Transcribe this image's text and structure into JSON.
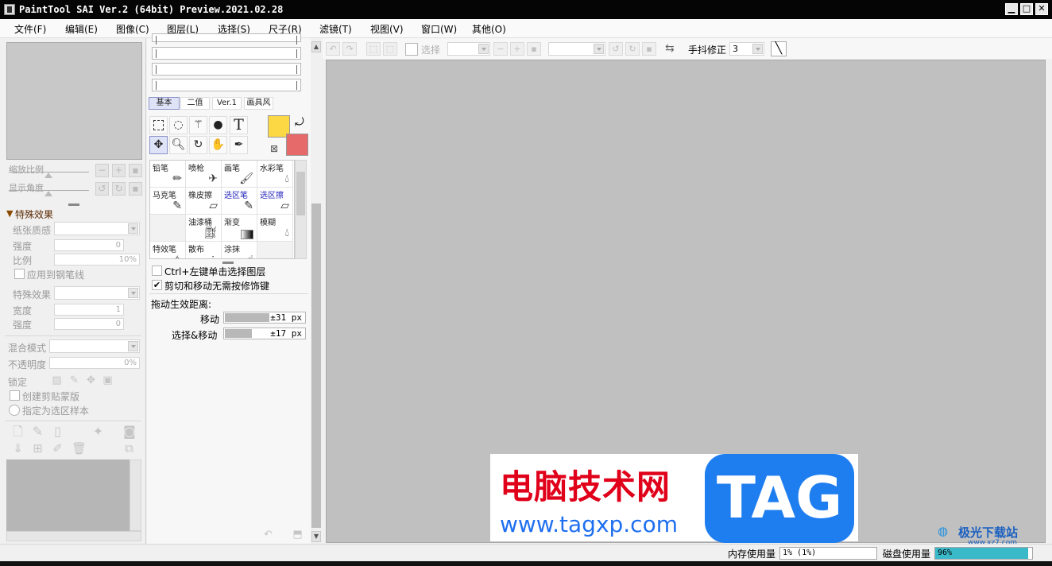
{
  "window": {
    "title": "PaintTool SAI Ver.2 (64bit) Preview.2021.02.28",
    "minimize": "▁",
    "maximize": "□",
    "close": "✕"
  },
  "menu": [
    "文件(F)",
    "编辑(E)",
    "图像(C)",
    "图层(L)",
    "选择(S)",
    "尺子(R)",
    "滤镜(T)",
    "视图(V)",
    "窗口(W)",
    "其他(O)"
  ],
  "navigator": {
    "zoom_label": "缩放比例",
    "angle_label": "显示角度"
  },
  "effects": {
    "header": "特殊效果",
    "paper_texture": "纸张质感",
    "strength": "强度",
    "strength_value": "0",
    "scale": "比例",
    "scale_value": "10%",
    "apply_to_pen": "应用到钢笔线",
    "special_effect": "特殊效果",
    "width": "宽度",
    "width_value": "1",
    "strength2": "强度",
    "strength2_value": "0"
  },
  "layer": {
    "blend_mode": "混合模式",
    "opacity": "不透明度",
    "opacity_value": "0%",
    "lock": "锁定",
    "clip_mask": "创建剪贴蒙版",
    "selection_source": "指定为选区样本"
  },
  "tool_tabs": [
    "基本",
    "二值",
    "Ver.1",
    "画具风"
  ],
  "colors": {
    "primary": "#fcd844",
    "secondary": "#e66a6a",
    "selection_blue": "#dfe3f7"
  },
  "tools": [
    "rect-select",
    "lasso",
    "magic-wand",
    "shape",
    "text",
    "move",
    "zoom",
    "rotate",
    "hand",
    "eyedropper"
  ],
  "text_tool_glyph": "T",
  "brushes": [
    {
      "label": "铅笔",
      "icon": "pencil-icon",
      "blue": false
    },
    {
      "label": "喷枪",
      "icon": "airbrush-icon",
      "blue": false
    },
    {
      "label": "画笔",
      "icon": "brush-icon",
      "blue": false
    },
    {
      "label": "水彩笔",
      "icon": "watercolor-icon",
      "blue": false
    },
    {
      "label": "马克笔",
      "icon": "marker-icon",
      "blue": false
    },
    {
      "label": "橡皮擦",
      "icon": "eraser-icon",
      "blue": false
    },
    {
      "label": "选区笔",
      "icon": "selection-pen-icon",
      "blue": true
    },
    {
      "label": "选区擦",
      "icon": "selection-eraser-icon",
      "blue": true
    },
    {
      "label": "",
      "icon": "",
      "blue": false
    },
    {
      "label": "油漆桶",
      "icon": "bucket-icon",
      "blue": false
    },
    {
      "label": "渐变",
      "icon": "gradient-icon",
      "blue": false
    },
    {
      "label": "模糊",
      "icon": "blur-icon",
      "blue": false
    },
    {
      "label": "特效笔",
      "icon": "effect-pen-icon",
      "blue": false
    },
    {
      "label": "散布",
      "icon": "scatter-icon",
      "blue": false
    },
    {
      "label": "涂抹",
      "icon": "smudge-icon",
      "blue": false
    },
    {
      "label": "",
      "icon": "",
      "blue": false
    }
  ],
  "move_options": {
    "ctrl_select": "Ctrl+左键单击选择图层",
    "ctrl_checked": false,
    "no_modifier": "剪切和移动无需按修饰键",
    "no_modifier_checked": true,
    "drag_distance": "拖动生效距离:",
    "move_label": "移动",
    "move_value": "±31 px",
    "move_fill": 0.56,
    "select_move_label": "选择&移动",
    "select_move_value": "±17 px",
    "select_move_fill": 0.34
  },
  "toolbar": {
    "select_label": "选择",
    "stabilizer_label": "手抖修正",
    "stabilizer_value": "3"
  },
  "status": {
    "memory_label": "内存使用量",
    "memory_value": "1% (1%)",
    "disk_label": "磁盘使用量",
    "disk_value": "96%"
  },
  "watermark": {
    "cn": "电脑技术网",
    "url": "www.tagxp.com",
    "tag": "TAG",
    "corner": "极光下载站",
    "corner_url": "www.xz7.com"
  }
}
